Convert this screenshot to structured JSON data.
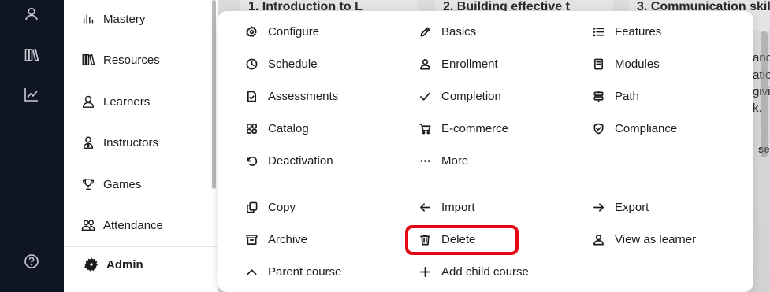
{
  "rail": {
    "icons": [
      "user-icon",
      "library-icon",
      "chart-icon",
      "help-icon"
    ]
  },
  "sidebar": {
    "items": [
      {
        "label": "Mastery",
        "icon": "bar-chart-icon"
      },
      {
        "label": "Resources",
        "icon": "books-icon"
      },
      {
        "label": "Learners",
        "icon": "person-icon"
      },
      {
        "label": "Instructors",
        "icon": "instructor-icon"
      },
      {
        "label": "Games",
        "icon": "trophy-icon"
      },
      {
        "label": "Attendance",
        "icon": "people-icon"
      }
    ],
    "admin_label": "Admin"
  },
  "background": {
    "cards": [
      "1. Introduction to L",
      "2. Building effective t",
      "3. Communication skil"
    ],
    "edge_lines": [
      "and",
      "atio",
      "givi",
      "k.",
      "se"
    ]
  },
  "menu": {
    "top": [
      {
        "label": "Configure",
        "icon": "gear-icon"
      },
      {
        "label": "Basics",
        "icon": "pencil-icon"
      },
      {
        "label": "Features",
        "icon": "list-icon"
      },
      {
        "label": "Schedule",
        "icon": "clock-icon"
      },
      {
        "label": "Enrollment",
        "icon": "person-icon"
      },
      {
        "label": "Modules",
        "icon": "book-icon"
      },
      {
        "label": "Assessments",
        "icon": "doc-check-icon"
      },
      {
        "label": "Completion",
        "icon": "check-icon"
      },
      {
        "label": "Path",
        "icon": "signpost-icon"
      },
      {
        "label": "Catalog",
        "icon": "grid-icon"
      },
      {
        "label": "E-commerce",
        "icon": "cart-icon"
      },
      {
        "label": "Compliance",
        "icon": "shield-check-icon"
      },
      {
        "label": "Deactivation",
        "icon": "undo-icon"
      },
      {
        "label": "More",
        "icon": "more-icon"
      }
    ],
    "bottom": [
      {
        "label": "Copy",
        "icon": "copy-icon"
      },
      {
        "label": "Import",
        "icon": "arrow-left-icon"
      },
      {
        "label": "Export",
        "icon": "arrow-right-icon"
      },
      {
        "label": "Archive",
        "icon": "archive-icon"
      },
      {
        "label": "Delete",
        "icon": "trash-icon"
      },
      {
        "label": "View as learner",
        "icon": "person-icon"
      },
      {
        "label": "Parent course",
        "icon": "chevron-up-icon"
      },
      {
        "label": "Add child course",
        "icon": "plus-icon"
      }
    ]
  },
  "colors": {
    "highlight": "#e30613",
    "rail": "#0f1523"
  }
}
